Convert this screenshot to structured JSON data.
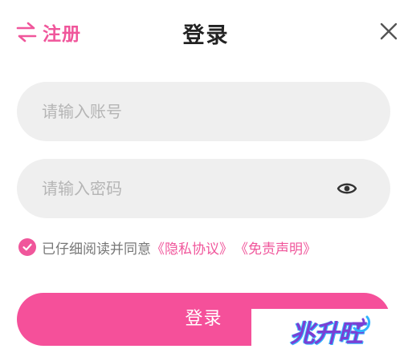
{
  "header": {
    "switch_label": "注册",
    "title": "登录",
    "switch_icon": "swap-arrows-icon",
    "close_icon": "close-icon"
  },
  "account": {
    "placeholder": "请输入账号",
    "value": ""
  },
  "password": {
    "placeholder": "请输入密码",
    "value": "",
    "toggle_icon": "eye-icon"
  },
  "agreement": {
    "checked": true,
    "check_icon": "checkmark-icon",
    "text": "已仔细阅读并同意",
    "privacy_link": "《隐私协议》",
    "disclaimer_link": "《免责声明》"
  },
  "login": {
    "label": "登录"
  },
  "watermark": {
    "text": "兆升旺"
  },
  "colors": {
    "accent": "#f0569b",
    "button": "#f5509a",
    "field_bg": "#efefef",
    "title": "#222222"
  }
}
